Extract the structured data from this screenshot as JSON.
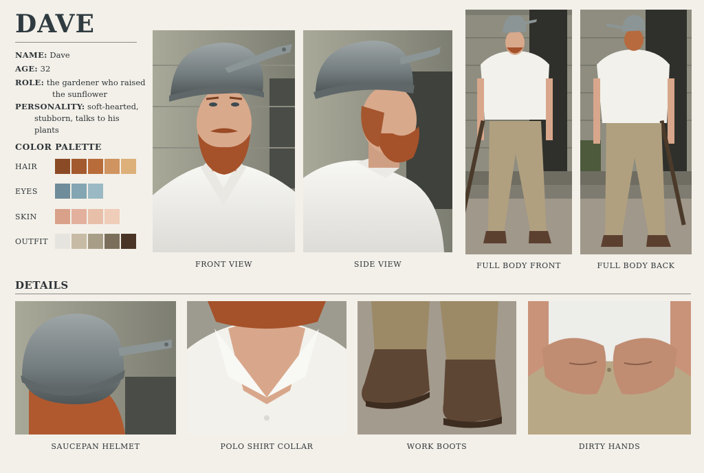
{
  "sheet": {
    "title": "DAVE",
    "name_label": "NAME:",
    "name_value": "Dave",
    "age_label": "AGE:",
    "age_value": "32",
    "role_label": "ROLE:",
    "role_line1": "the gardener who raised",
    "role_line2": "the sunflower",
    "personality_label": "PERSONALITY:",
    "personality_line1": "soft-hearted,",
    "personality_line2": "stubborn, talks to his plants"
  },
  "palette": {
    "title": "COLOR PALETTE",
    "rows": [
      {
        "label": "HAIR",
        "colors": [
          "#8a4a26",
          "#a35a2e",
          "#b86c3a",
          "#cf9460",
          "#ddb07a"
        ]
      },
      {
        "label": "EYES",
        "colors": [
          "#6f8c9a",
          "#84a5b2",
          "#9bb9c4"
        ]
      },
      {
        "label": "SKIN",
        "colors": [
          "#d9a18a",
          "#e2b09c",
          "#e8bfa9",
          "#efcdb9"
        ]
      },
      {
        "label": "OUTFIT",
        "colors": [
          "#e6e4df",
          "#c7bba5",
          "#a89e88",
          "#7b6f5c",
          "#4a3426"
        ]
      }
    ]
  },
  "views": {
    "front": "FRONT VIEW",
    "side": "SIDE VIEW",
    "full_front": "FULL BODY FRONT",
    "full_back": "FULL BODY BACK"
  },
  "details": {
    "title": "DETAILS",
    "helmet": "SAUCEPAN HELMET",
    "collar": "POLO SHIRT COLLAR",
    "boots": "WORK BOOTS",
    "hands": "DIRTY HANDS"
  }
}
